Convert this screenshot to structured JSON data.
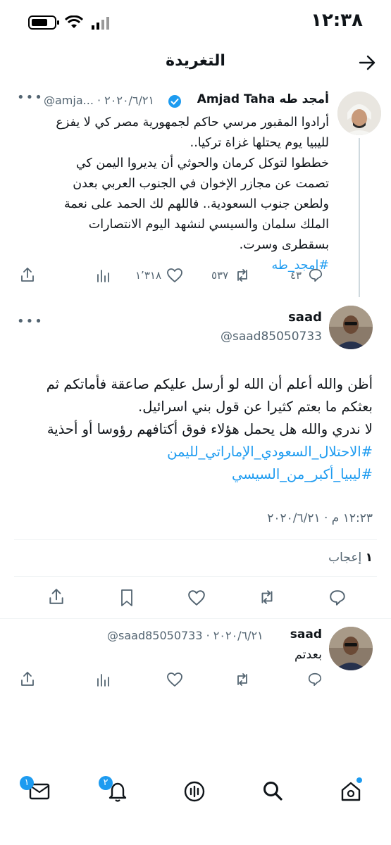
{
  "status_bar": {
    "time": "١٢:٣٨"
  },
  "header": {
    "title": "التغريدة"
  },
  "parent_tweet": {
    "display_name": "أمجد طه Amjad Taha",
    "meta": "@amja... · ٢٠٢٠/٦/٢١",
    "text_lines": [
      "أرادوا المقبور مرسي حاكم لجمهورية مصر كي لا يفزع",
      "لليبيا يوم يحتلها غزاة تركيا..",
      "خططوا لتوكل كرمان والحوثي أن يديروا اليمن كي",
      "تصمت عن مجازر الإخوان في الجنوب العربي بعدن",
      "ولطعن جنوب السعودية.. فاللهم لك الحمد على نعمة",
      "الملك سلمان والسيسي لنشهد اليوم الانتصارات",
      "بسقطرى وسرت."
    ],
    "hashtag": "#امجد_طه",
    "replies": "٤٣",
    "retweets": "٥٣٧",
    "likes": "١٬٣١٨"
  },
  "main_tweet": {
    "display_name": "saad",
    "handle": "@saad85050733",
    "text_lines": [
      "أظن والله أعلم أن الله لو أرسل عليكم صاعقة فأماتكم ثم",
      "بعثكم ما بعتم كثيرا عن قول بني اسرائيل.",
      "لا ندري والله هل يحمل هؤلاء فوق أكتافهم رؤوسا أو أحذية"
    ],
    "hashtags": [
      "#الاحتلال_السعودي_الإماراتي_لليمن",
      "#ليبيا_أكبر_من_السيسي"
    ],
    "timestamp": "١٢:٢٣ م · ٢٠٢٠/٦/٢١",
    "likes_count": "١",
    "likes_label": "إعجاب"
  },
  "reply_tweet": {
    "display_name": "saad",
    "meta": "@saad85050733 · ٢٠٢٠/٦/٢١",
    "text": "بعدتم"
  },
  "bottom_nav": {
    "notifications_badge": "٢",
    "messages_badge": "١"
  }
}
